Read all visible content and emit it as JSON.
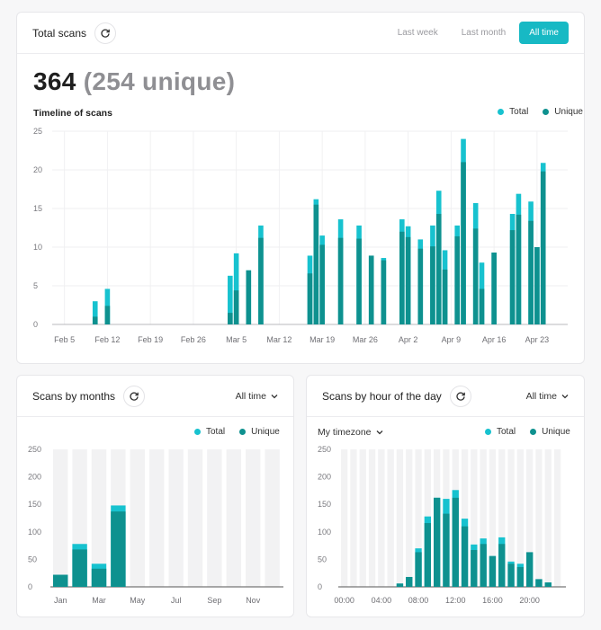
{
  "colors": {
    "total": "#17c2cf",
    "unique": "#0e918f",
    "accent": "#17b9c4"
  },
  "total_card": {
    "title": "Total scans",
    "tabs": [
      "Last week",
      "Last month",
      "All time"
    ],
    "active_tab": 2,
    "big_number": "364",
    "big_unique": "(254 unique)",
    "subtitle": "Timeline of scans",
    "legend_total": "Total",
    "legend_unique": "Unique"
  },
  "months_card": {
    "title": "Scans by months",
    "range": "All time",
    "legend_total": "Total",
    "legend_unique": "Unique"
  },
  "hours_card": {
    "title": "Scans by hour of the day",
    "range": "All time",
    "timezone": "My timezone",
    "legend_total": "Total",
    "legend_unique": "Unique"
  },
  "chart_data": [
    {
      "type": "bar",
      "name": "timeline",
      "title": "Timeline of scans",
      "ylim": [
        0,
        25
      ],
      "yticks": [
        0,
        5,
        10,
        15,
        20,
        25
      ],
      "x_tick_labels": [
        "Feb 5",
        "Feb 12",
        "Feb 19",
        "Feb 26",
        "Mar 5",
        "Mar 12",
        "Mar 19",
        "Mar 26",
        "Apr 2",
        "Apr 9",
        "Apr 16",
        "Apr 23"
      ],
      "x_start": "Feb 3",
      "x_end": "Apr 28",
      "series": [
        {
          "name": "Total",
          "points": [
            [
              "Feb 10",
              3
            ],
            [
              "Feb 12",
              4.6
            ],
            [
              "Mar 4",
              6.3
            ],
            [
              "Mar 5",
              9.2
            ],
            [
              "Mar 7",
              7
            ],
            [
              "Mar 9",
              12.8
            ],
            [
              "Mar 17",
              8.9
            ],
            [
              "Mar 18",
              16.2
            ],
            [
              "Mar 19",
              11.5
            ],
            [
              "Mar 22",
              13.6
            ],
            [
              "Mar 25",
              12.8
            ],
            [
              "Mar 27",
              8.9
            ],
            [
              "Mar 29",
              8.6
            ],
            [
              "Apr 1",
              13.6
            ],
            [
              "Apr 2",
              12.7
            ],
            [
              "Apr 4",
              11
            ],
            [
              "Apr 6",
              12.8
            ],
            [
              "Apr 7",
              17.3
            ],
            [
              "Apr 8",
              9.6
            ],
            [
              "Apr 10",
              12.8
            ],
            [
              "Apr 11",
              24
            ],
            [
              "Apr 13",
              15.7
            ],
            [
              "Apr 14",
              8
            ],
            [
              "Apr 16",
              9.3
            ],
            [
              "Apr 19",
              14.3
            ],
            [
              "Apr 20",
              16.9
            ],
            [
              "Apr 22",
              15.9
            ],
            [
              "Apr 23",
              10
            ],
            [
              "Apr 24",
              20.9
            ]
          ]
        },
        {
          "name": "Unique",
          "points": [
            [
              "Feb 10",
              1
            ],
            [
              "Feb 12",
              2.4
            ],
            [
              "Mar 4",
              1.5
            ],
            [
              "Mar 5",
              4.4
            ],
            [
              "Mar 7",
              7
            ],
            [
              "Mar 9",
              11.2
            ],
            [
              "Mar 17",
              6.6
            ],
            [
              "Mar 18",
              15.5
            ],
            [
              "Mar 19",
              10.3
            ],
            [
              "Mar 22",
              11.2
            ],
            [
              "Mar 25",
              11.1
            ],
            [
              "Mar 27",
              8.9
            ],
            [
              "Mar 29",
              8.3
            ],
            [
              "Apr 1",
              12
            ],
            [
              "Apr 2",
              11.3
            ],
            [
              "Apr 4",
              9.8
            ],
            [
              "Apr 6",
              10.1
            ],
            [
              "Apr 7",
              14.3
            ],
            [
              "Apr 8",
              7.1
            ],
            [
              "Apr 10",
              11.4
            ],
            [
              "Apr 11",
              21
            ],
            [
              "Apr 13",
              12.4
            ],
            [
              "Apr 14",
              4.6
            ],
            [
              "Apr 16",
              9.3
            ],
            [
              "Apr 19",
              12.2
            ],
            [
              "Apr 20",
              14.2
            ],
            [
              "Apr 22",
              13.4
            ],
            [
              "Apr 23",
              10
            ],
            [
              "Apr 24",
              19.8
            ]
          ]
        }
      ]
    },
    {
      "type": "bar",
      "name": "months",
      "ylim": [
        0,
        250
      ],
      "yticks": [
        0,
        50,
        100,
        150,
        200,
        250
      ],
      "categories": [
        "Jan",
        "Feb",
        "Mar",
        "Apr",
        "May",
        "Jun",
        "Jul",
        "Aug",
        "Sep",
        "Oct",
        "Nov",
        "Dec"
      ],
      "x_tick_labels": [
        "Jan",
        "Mar",
        "May",
        "Jul",
        "Sep",
        "Nov"
      ],
      "series": [
        {
          "name": "Total",
          "values": [
            22,
            78,
            42,
            148,
            0,
            0,
            0,
            0,
            0,
            0,
            0,
            0
          ]
        },
        {
          "name": "Unique",
          "values": [
            22,
            68,
            33,
            137,
            0,
            0,
            0,
            0,
            0,
            0,
            0,
            0
          ]
        }
      ]
    },
    {
      "type": "bar",
      "name": "hours",
      "ylim": [
        0,
        250
      ],
      "yticks": [
        0,
        50,
        100,
        150,
        200,
        250
      ],
      "categories": [
        "00",
        "01",
        "02",
        "03",
        "04",
        "05",
        "06",
        "07",
        "08",
        "09",
        "10",
        "11",
        "12",
        "13",
        "14",
        "15",
        "16",
        "17",
        "18",
        "19",
        "20",
        "21",
        "22",
        "23"
      ],
      "x_tick_labels": [
        "00:00",
        "04:00",
        "08:00",
        "12:00",
        "16:00",
        "20:00"
      ],
      "series": [
        {
          "name": "Total",
          "values": [
            0,
            0,
            0,
            0,
            0,
            0,
            6,
            18,
            70,
            128,
            162,
            160,
            176,
            124,
            77,
            88,
            56,
            90,
            46,
            42,
            63,
            14,
            8,
            0
          ]
        },
        {
          "name": "Unique",
          "values": [
            0,
            0,
            0,
            0,
            0,
            0,
            6,
            18,
            63,
            116,
            162,
            133,
            162,
            110,
            67,
            78,
            56,
            78,
            42,
            36,
            63,
            14,
            8,
            0
          ]
        }
      ]
    }
  ]
}
